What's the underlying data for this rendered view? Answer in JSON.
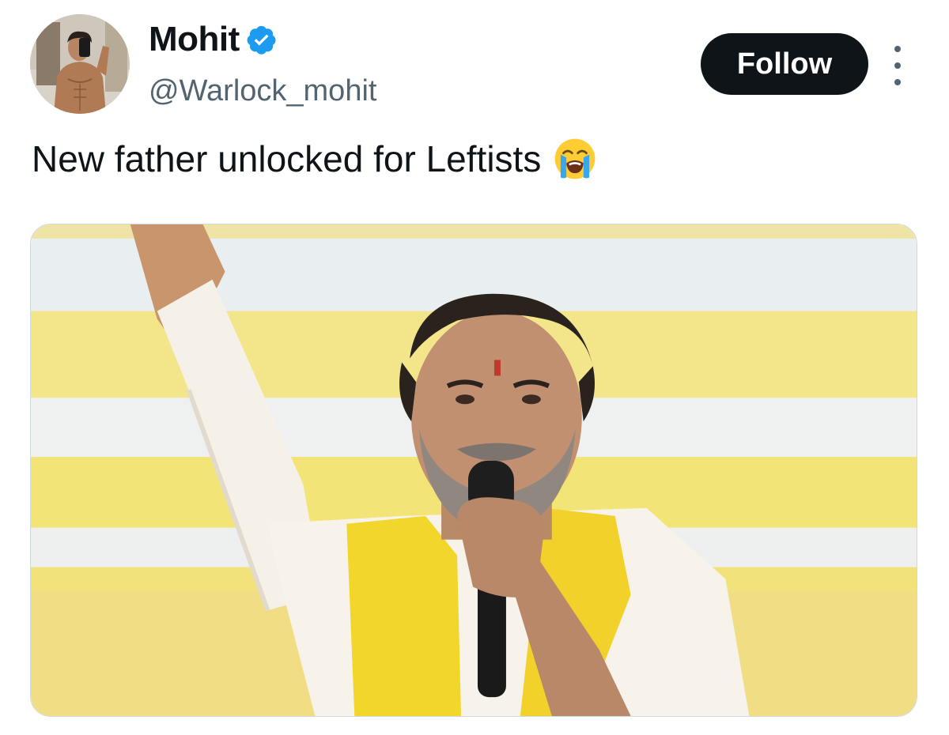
{
  "tweet": {
    "author": {
      "display_name": "Mohit",
      "handle": "@Warlock_mohit",
      "verified": true,
      "avatar_icon": "profile-photo-avatar"
    },
    "follow_label": "Follow",
    "more_icon": "more-options-icon",
    "text": "New father unlocked for Leftists",
    "emoji_icon": "loudly-crying-face-emoji",
    "media_icon": "attached-photo"
  },
  "colors": {
    "text_primary": "#0f1419",
    "text_secondary": "#536471",
    "verified_badge": "#1d9bf0",
    "follow_button_bg": "#0f1419",
    "follow_button_text": "#ffffff"
  }
}
